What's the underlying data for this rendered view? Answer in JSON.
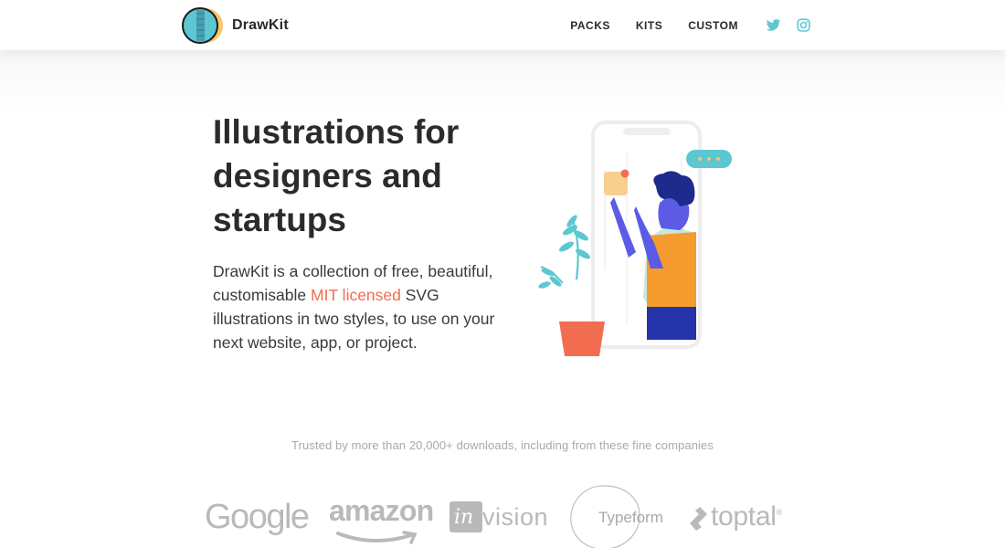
{
  "header": {
    "logo_text": "DrawKit",
    "nav": [
      "PACKS",
      "KITS",
      "CUSTOM"
    ],
    "social": [
      "twitter-icon",
      "instagram-icon"
    ]
  },
  "hero": {
    "title": "Illustrations for designers and startups",
    "desc_before": "DrawKit is a collection of free, beautiful, customisable ",
    "desc_link": "MIT licensed",
    "desc_after": " SVG illustrations in two styles, to use on your next website, app, or project."
  },
  "trusted": {
    "text": "Trusted by more than 20,000+ downloads, including from these fine companies",
    "companies": {
      "google": "Google",
      "amazon": "amazon",
      "invision_in": "in",
      "invision_rest": "vision",
      "typeform": "Typeform",
      "toptal": "toptal"
    }
  },
  "colors": {
    "accent": "#f26d50",
    "teal": "#5cc7d0",
    "text": "#2b2b2b",
    "muted": "#a9a9a9"
  }
}
